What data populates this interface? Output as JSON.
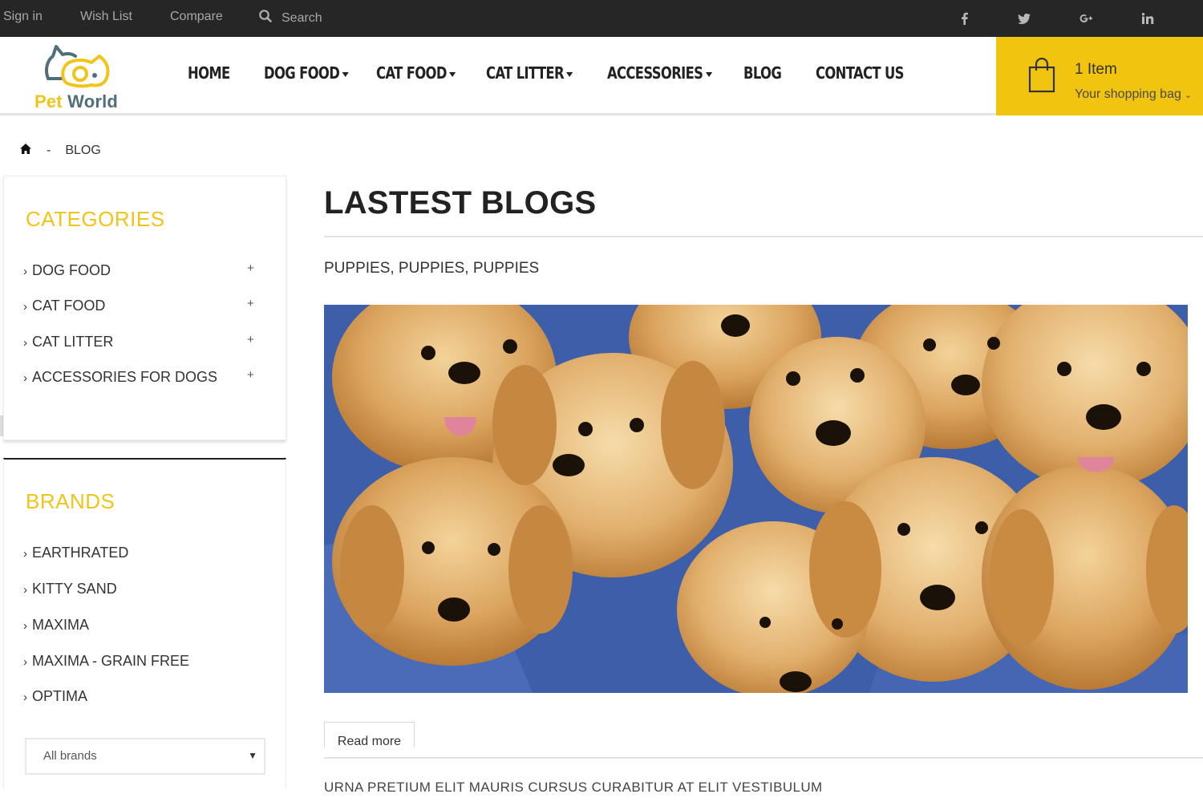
{
  "topbar": {
    "sign_in": "Sign in",
    "wish_list": "Wish List",
    "compare": "Compare",
    "search_placeholder": "Search",
    "social": [
      "facebook-icon",
      "twitter-icon",
      "google-plus-icon",
      "linkedin-icon"
    ]
  },
  "header": {
    "logo_pet": "Pet",
    "logo_world": "World",
    "nav": [
      {
        "label": "HOME",
        "dropdown": false
      },
      {
        "label": "DOG FOOD",
        "dropdown": true
      },
      {
        "label": "CAT FOOD",
        "dropdown": true
      },
      {
        "label": "CAT LITTER",
        "dropdown": true
      },
      {
        "label": "ACCESSORIES",
        "dropdown": true
      },
      {
        "label": "BLOG",
        "dropdown": false
      },
      {
        "label": "CONTACT US",
        "dropdown": false
      }
    ],
    "cart": {
      "count": "1 Item",
      "label": "Your shopping bag"
    }
  },
  "breadcrumb": {
    "separator": "-",
    "current": "BLOG"
  },
  "sidebar": {
    "categories_title": "CATEGORIES",
    "categories": [
      "DOG FOOD",
      "CAT FOOD",
      "CAT LITTER",
      "ACCESSORIES FOR DOGS"
    ],
    "expand_symbol": "+",
    "brands_title": "BRANDS",
    "brands": [
      "EARTHRATED",
      "KITTY SAND",
      "MAXIMA",
      "MAXIMA - GRAIN FREE",
      "OPTIMA"
    ],
    "brand_select": "All brands"
  },
  "main": {
    "title": "LASTEST BLOGS",
    "post_title": "PUPPIES, PUPPIES, PUPPIES",
    "read_more": "Read more",
    "next_post_title": "URNA PRETIUM ELIT MAURIS CURSUS CURABITUR AT ELIT VESTIBULUM"
  },
  "colors": {
    "accent": "#f1c40f",
    "topbar": "#262626",
    "logo_blue": "#4f6f7b",
    "blanket": "#3f5fa8",
    "puppy": "#d9a35a"
  }
}
